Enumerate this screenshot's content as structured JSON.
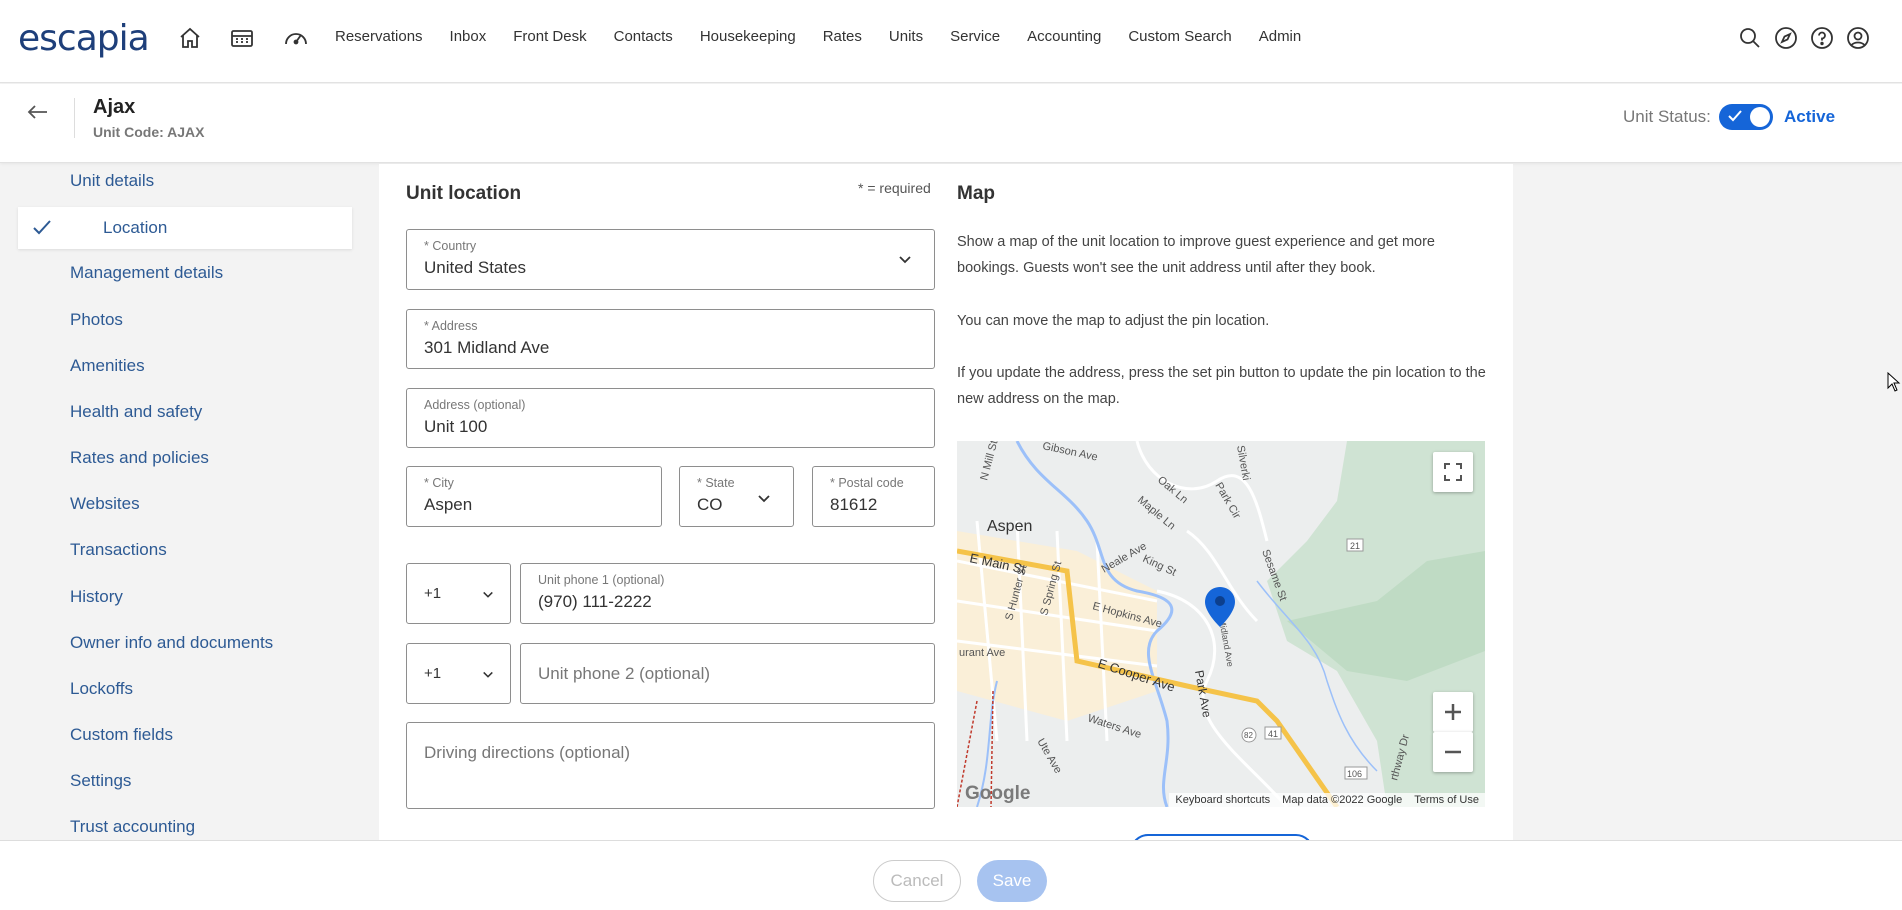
{
  "app": {
    "logo_text": "escapia"
  },
  "nav": {
    "links": [
      "Reservations",
      "Inbox",
      "Front Desk",
      "Contacts",
      "Housekeeping",
      "Rates",
      "Units",
      "Service",
      "Accounting",
      "Custom Search",
      "Admin"
    ],
    "icons": [
      "home-icon",
      "calendar-icon",
      "dashboard-icon"
    ],
    "right_icons": [
      "search-icon",
      "compass-icon",
      "help-icon",
      "account-icon"
    ]
  },
  "header": {
    "unit_name": "Ajax",
    "unit_code": "Unit Code: AJAX",
    "status_label": "Unit Status:",
    "status_value": "Active",
    "status_on": true
  },
  "sidebar": {
    "items": [
      "Unit details",
      "Location",
      "Management details",
      "Photos",
      "Amenities",
      "Health and safety",
      "Rates and policies",
      "Websites",
      "Transactions",
      "History",
      "Owner info and documents",
      "Lockoffs",
      "Custom fields",
      "Settings",
      "Trust accounting"
    ],
    "active": "Location"
  },
  "location": {
    "title": "Unit location",
    "required_note": "* = required",
    "country": {
      "label": "* Country",
      "value": "United States"
    },
    "address": {
      "label": "* Address",
      "value": "301 Midland Ave"
    },
    "address2": {
      "label": "Address (optional)",
      "value": "Unit 100"
    },
    "city": {
      "label": "* City",
      "value": "Aspen"
    },
    "state": {
      "label": "* State",
      "value": "CO"
    },
    "postal": {
      "label": "* Postal code",
      "value": "81612"
    },
    "phone1": {
      "code": "+1",
      "label": "Unit phone 1 (optional)",
      "value": "(970) 111-2222"
    },
    "phone2": {
      "code": "+1",
      "placeholder": "Unit phone 2 (optional)"
    },
    "directions": {
      "placeholder": "Driving directions (optional)"
    }
  },
  "map": {
    "title": "Map",
    "para1": "Show a map of the unit location to improve guest experience and get more bookings. Guests won't see the unit address until after they book.",
    "para2": "You can move the map to adjust the pin location.",
    "para3": "If you update the address, press the set pin button to update the pin location to the new address on the map.",
    "labels": {
      "city": "Aspen",
      "main_st": "E Main St",
      "cooper": "E Cooper Ave",
      "hopkins": "E Hopkins Ave",
      "park_ave": "Park Ave",
      "midland": "Midland Ave",
      "waters": "Waters Ave",
      "park_cir": "Park Cir",
      "durant": "urant Ave",
      "neale": "Neale Ave",
      "king": "King St",
      "oak": "Oak Ln",
      "maple": "Maple Ln",
      "gibson": "Gibson Ave",
      "mill": "N Mill St",
      "hunter": "S Hunter St",
      "spring": "S Spring St",
      "ute": "Ute Ave",
      "sesame": "Sesame St",
      "silverking": "Silverki",
      "route_21": "21",
      "route_41": "41",
      "route_106": "106",
      "route_82": "82",
      "hwy_dr": "rthway Dr"
    },
    "footer_shortcuts": "Keyboard shortcuts",
    "footer_data": "Map data ©2022 Google",
    "footer_terms": "Terms of Use",
    "google": "Google",
    "zoom_in": "+",
    "zoom_out": "−"
  },
  "footer": {
    "cancel": "Cancel",
    "save": "Save"
  },
  "colors": {
    "brand": "#1e3f7a",
    "accent": "#1565d8",
    "link": "#2d5a94"
  }
}
